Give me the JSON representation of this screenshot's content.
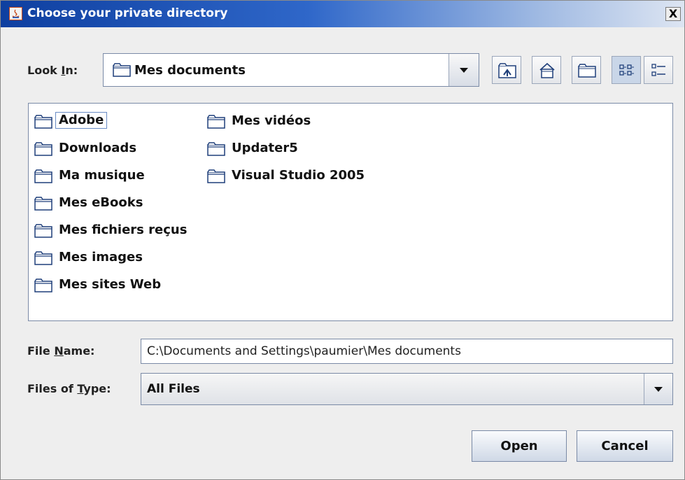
{
  "window": {
    "title": "Choose your private directory",
    "close_label": "X"
  },
  "look_in": {
    "label_pre": "Look ",
    "label_mnemonic": "I",
    "label_post": "n:",
    "value": "Mes documents"
  },
  "toolbar": {
    "buttons": [
      "up-one-level",
      "home",
      "new-folder",
      "list-view",
      "details-view"
    ]
  },
  "files": [
    {
      "name": "Adobe",
      "selected": true
    },
    {
      "name": "Downloads"
    },
    {
      "name": "Ma musique"
    },
    {
      "name": "Mes eBooks"
    },
    {
      "name": "Mes fichiers reçus"
    },
    {
      "name": "Mes images"
    },
    {
      "name": "Mes sites Web"
    },
    {
      "name": "Mes vidéos"
    },
    {
      "name": "Updater5"
    },
    {
      "name": "Visual Studio 2005"
    }
  ],
  "file_name": {
    "label_pre": "File ",
    "label_mnemonic": "N",
    "label_post": "ame:",
    "value": "C:\\Documents and Settings\\paumier\\Mes documents"
  },
  "file_type": {
    "label_pre": "Files of ",
    "label_mnemonic": "T",
    "label_post": "ype:",
    "value": "All Files"
  },
  "actions": {
    "open_label": "Open",
    "cancel_label": "Cancel"
  },
  "colors": {
    "title_gradient_start": "#0e3fa0",
    "title_gradient_end": "#dde5f2",
    "folder_fill": "#ffffff",
    "folder_stroke": "#1f3f7a"
  }
}
